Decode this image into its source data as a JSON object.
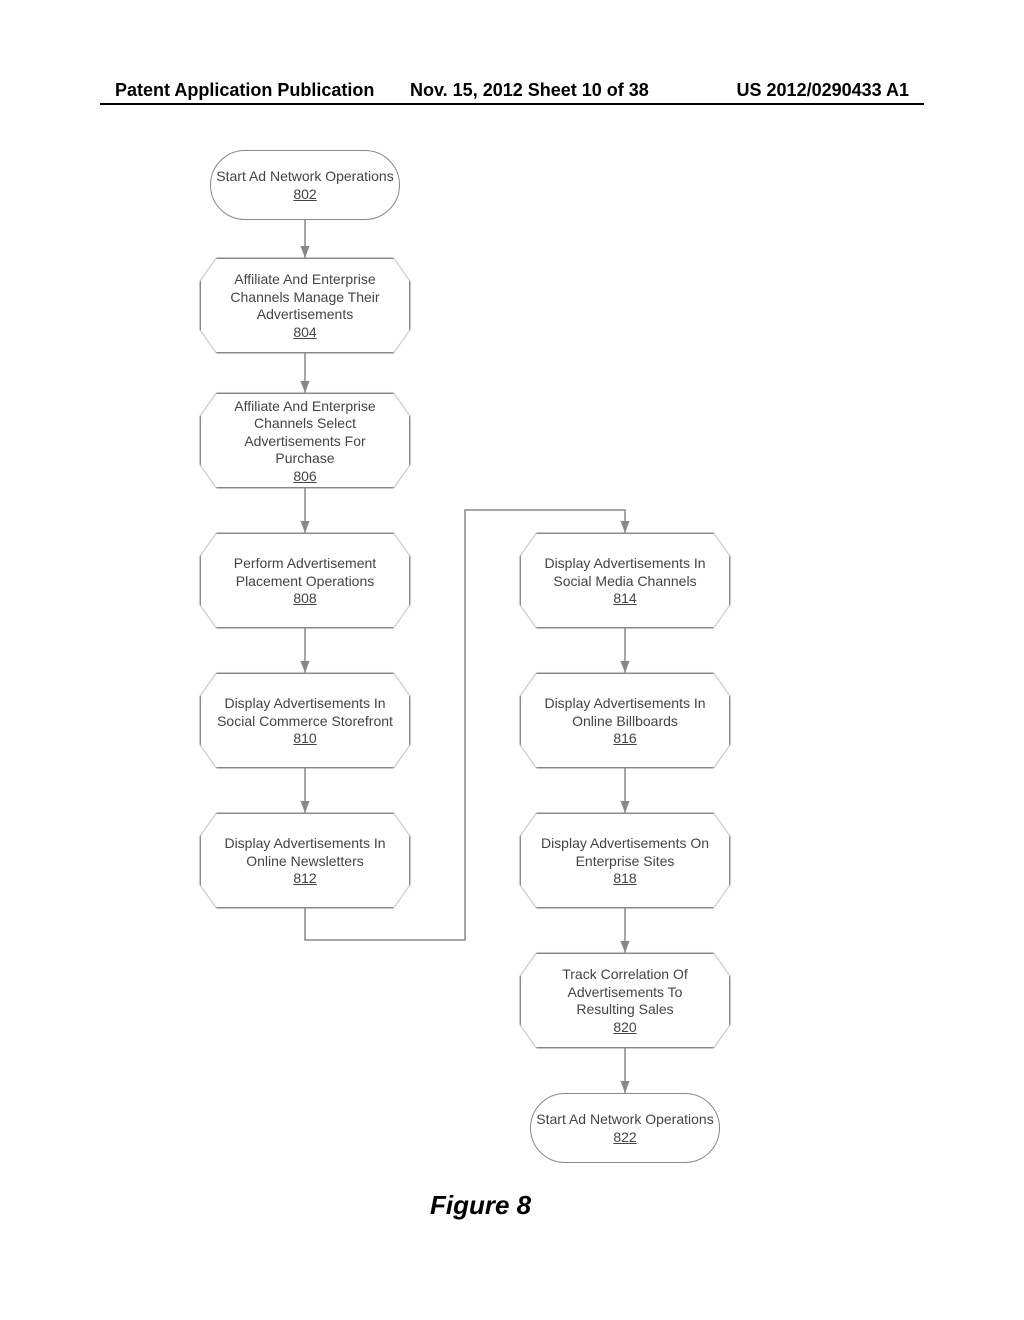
{
  "header": {
    "left": "Patent Application Publication",
    "middle": "Nov. 15, 2012  Sheet 10 of 38",
    "right": "US 2012/0290433 A1"
  },
  "figure_caption": "Figure 8",
  "nodes": {
    "n802": {
      "text": "Start Ad Network Operations",
      "ref": "802"
    },
    "n804": {
      "text": "Affiliate And Enterprise Channels Manage Their Advertisements",
      "ref": "804"
    },
    "n806": {
      "text": "Affiliate And Enterprise Channels Select Advertisements For Purchase",
      "ref": "806"
    },
    "n808": {
      "text": "Perform Advertisement Placement Operations",
      "ref": "808"
    },
    "n810": {
      "text": "Display Advertisements In Social Commerce Storefront",
      "ref": "810"
    },
    "n812": {
      "text": "Display Advertisements In Online Newsletters",
      "ref": "812"
    },
    "n814": {
      "text": "Display Advertisements In Social Media Channels",
      "ref": "814"
    },
    "n816": {
      "text": "Display Advertisements In Online Billboards",
      "ref": "816"
    },
    "n818": {
      "text": "Display Advertisements On Enterprise Sites",
      "ref": "818"
    },
    "n820": {
      "text": "Track Correlation Of Advertisements To Resulting Sales",
      "ref": "820"
    },
    "n822": {
      "text": "Start Ad Network Operations",
      "ref": "822"
    }
  }
}
